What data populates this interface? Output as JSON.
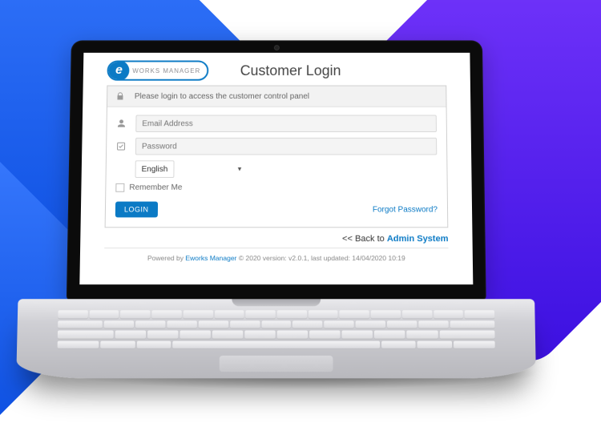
{
  "brand": {
    "mark": "e",
    "text": "WORKS MANAGER"
  },
  "page_title": "Customer Login",
  "login_box": {
    "heading": "Please login to access the customer control panel",
    "email_placeholder": "Email Address",
    "password_placeholder": "Password",
    "language_selected": "English",
    "remember_label": "Remember Me",
    "login_button": "LOGIN",
    "forgot_password": "Forgot Password?"
  },
  "back_prefix": "<< Back to ",
  "back_link_label": "Admin System",
  "footer": {
    "prefix": "Powered by ",
    "brand": "Eworks Manager",
    "suffix": " © 2020 version: v2.0.1, last updated: 14/04/2020 10:19"
  }
}
